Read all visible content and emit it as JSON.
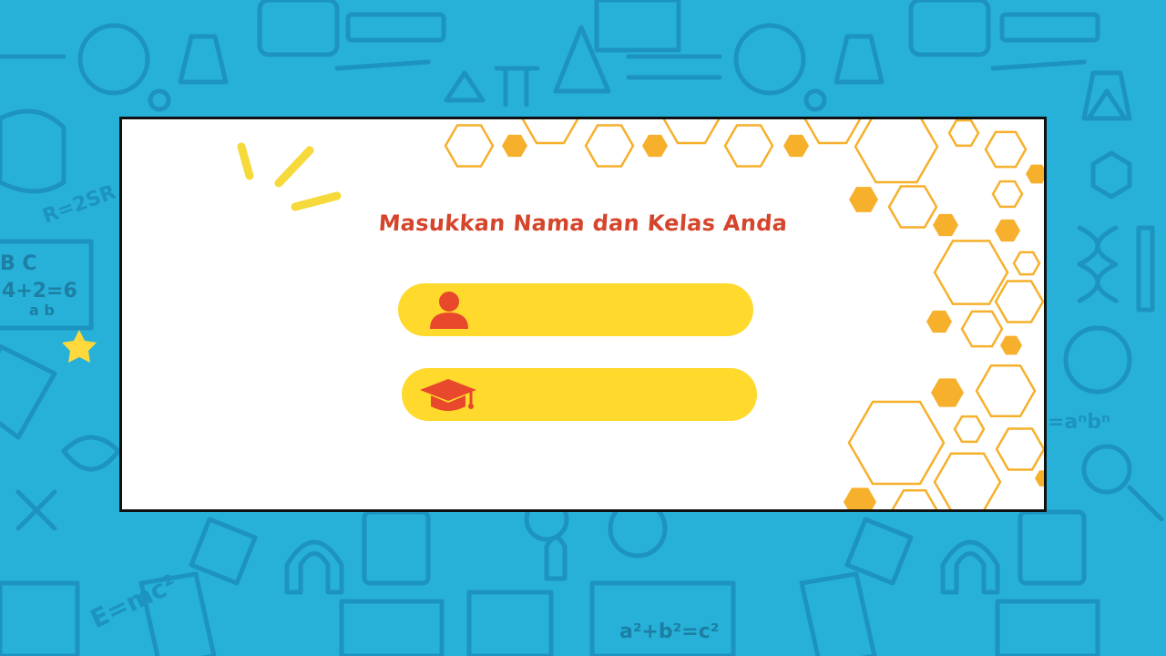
{
  "form": {
    "title": "Masukkan Nama dan Kelas Anda",
    "name_field": {
      "value": "",
      "placeholder": "",
      "icon": "user-icon"
    },
    "class_field": {
      "value": "",
      "placeholder": "",
      "icon": "graduation-cap-icon"
    }
  },
  "background": {
    "texts": [
      "B C",
      "4+2=6",
      "a b",
      "E=mc²",
      "a²+b²=c²",
      "R=2SR",
      "=aⁿbⁿ"
    ]
  },
  "colors": {
    "background": "#27b1d9",
    "title": "#d5452c",
    "field": "#ffd92b",
    "icon": "#e8482b",
    "hexagon": "#f6b02c"
  }
}
